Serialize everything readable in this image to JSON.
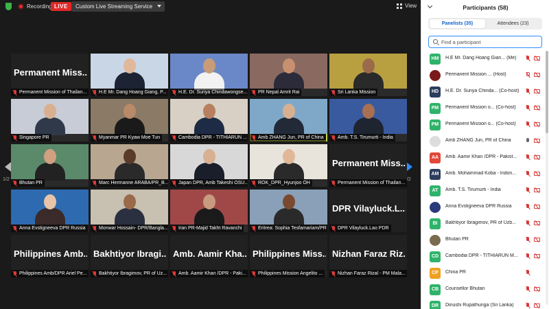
{
  "topbar": {
    "recording_label": "Recording",
    "live_label": "LIVE",
    "stream_service": "Custom Live Streaming Service",
    "view_label": "View"
  },
  "gallery": {
    "page_left": "1/2",
    "page_right": "1/2",
    "tiles": [
      {
        "label": "Permanent Mission of Thailan...",
        "big_name": "Permanent Miss...",
        "video": false,
        "scene": "#3a3a3a"
      },
      {
        "label": "H.E Mr. Dang Hoang Giang, P...",
        "video": true,
        "scene": "#c9d6e6",
        "skin": "#e0b89a",
        "suit": "#1c2433"
      },
      {
        "label": "H.E. Dr. Suriya Chindawongse...",
        "video": true,
        "scene": "#6a88c8",
        "skin": "#c99b78",
        "suit": "#f2f2f2"
      },
      {
        "label": "PR Nepal Amrit Rai",
        "video": true,
        "scene": "#8a6a60",
        "skin": "#c89070",
        "suit": "#2b2b3a"
      },
      {
        "label": "Sri Lanka Mission",
        "video": true,
        "scene": "#b8a040",
        "skin": "#9a6a4a",
        "suit": "#2a2a2a"
      },
      {
        "label": "Singapore PR",
        "video": true,
        "scene": "#c8ccd6",
        "skin": "#d8b090",
        "suit": "#30394a"
      },
      {
        "label": "Myanmar PR Kyaw Moe Tun",
        "video": true,
        "scene": "#8a7a66",
        "skin": "#b88a68",
        "suit": "#1a1a1a"
      },
      {
        "label": "Cambodia DPR - TITHIARUN ...",
        "video": true,
        "scene": "#d8d0c4",
        "skin": "#b88060",
        "suit": "#1d2b44"
      },
      {
        "label": "Amb ZHANG Jun, PR of China",
        "video": true,
        "scene": "#7fa8c8",
        "skin": "#d8b090",
        "suit": "#222a38",
        "active": true
      },
      {
        "label": "Amb. T.S. Tirumurti - India",
        "video": true,
        "scene": "#3a5aa0",
        "skin": "#a87050",
        "suit": "#1e2430"
      },
      {
        "label": "Bhutan PR",
        "video": true,
        "scene": "#5a8a6a",
        "skin": "#d0a080",
        "suit": "#222222"
      },
      {
        "label": "Marc Hermanne ARABA/PR_B...",
        "video": true,
        "scene": "#b8a690",
        "skin": "#5a3a28",
        "suit": "#2a2a2a"
      },
      {
        "label": "Japan DPR, Amb Takeshi OSU...",
        "video": true,
        "scene": "#d8d8d8",
        "skin": "#d8b090",
        "suit": "#1a1e2a"
      },
      {
        "label": "ROK_DPR_Hyunjoo OH",
        "video": true,
        "scene": "#e8e4dc",
        "skin": "#e0b898",
        "suit": "#2a2a2a"
      },
      {
        "label": "Permanent Mission of Thailan...",
        "big_name": "Permanent Miss...",
        "video": false,
        "scene": "#3a3a3a"
      },
      {
        "label": "Anna Evstigneeva DPR Russia",
        "video": true,
        "scene": "#2e6ab0",
        "skin": "#e8c4a8",
        "suit": "#3a2a2a"
      },
      {
        "label": "Monwar Hossain- DPR/Bangla...",
        "video": true,
        "scene": "#c8c0b0",
        "skin": "#9a6a4a",
        "suit": "#2a3040"
      },
      {
        "label": "Iran PR-Majid Takht Ravanchi",
        "video": true,
        "scene": "#a04848",
        "skin": "#c89a80",
        "suit": "#1a1a1a"
      },
      {
        "label": "Eritrea: Sophia Tesfamariam/PR",
        "video": true,
        "scene": "#8aa0b8",
        "skin": "#7a4a30",
        "suit": "#2a2a2a"
      },
      {
        "label": "DPR Vilayluck.Lao PDR",
        "big_name": "DPR Vilayluck.L...",
        "video": false,
        "scene": "#3a3a3a"
      },
      {
        "label": "Philippines Amb/DPR Ariel Pe...",
        "big_name": "Philippines Amb...",
        "video": false
      },
      {
        "label": "Bakhtiyor Ibragimov, PR of Uz...",
        "big_name": "Bakhtiyor Ibragi...",
        "video": false
      },
      {
        "label": "Amb. Aamir Khan /DPR - Paki...",
        "big_name": "Amb. Aamir Kha...",
        "video": false
      },
      {
        "label": "Philippines Mission Angelito ...",
        "big_name": "Philippines Miss...",
        "video": false
      },
      {
        "label": "Nizhan Faraz Rizal - PM Mala...",
        "big_name": "Nizhan Faraz Riz...",
        "video": false
      }
    ]
  },
  "participants": {
    "title": "Participants (58)",
    "tabs": [
      {
        "label": "Panelists (35)",
        "active": true
      },
      {
        "label": "Attendees (23)",
        "active": false
      }
    ],
    "search_placeholder": "Find a participant",
    "list": [
      {
        "initials": "HM",
        "color": "#2fb36a",
        "name": "H.E Mr. Dang Hoang Gian... (Me)",
        "mic": "off",
        "cam": "off"
      },
      {
        "initials": "",
        "color": "#7a1a1a",
        "round": true,
        "name": "Permanent Mission ... (Host)",
        "mic": "ring",
        "cam": "off"
      },
      {
        "initials": "HD",
        "color": "#2c3e5c",
        "name": "H.E. Dr. Suriya Chinda... (Co-host)",
        "mic": "off",
        "cam": "off"
      },
      {
        "initials": "PM",
        "color": "#2fb36a",
        "name": "Permanent Mission o... (Co-host)",
        "mic": "off",
        "cam": "off"
      },
      {
        "initials": "PM",
        "color": "#2fb36a",
        "name": "Permanent Mission o... (Co-host)",
        "mic": "off",
        "cam": "off"
      },
      {
        "initials": "",
        "color": "#dddddd",
        "round": true,
        "name": "Amb ZHANG Jun, PR of China",
        "mic": "on",
        "cam": "off"
      },
      {
        "initials": "AA",
        "color": "#e0483a",
        "name": "Amb. Aamir Khan /DPR - Pakist...",
        "mic": "off",
        "cam": "off"
      },
      {
        "initials": "AM",
        "color": "#2c3e5c",
        "name": "Amb. Mohammad Koba - Indon...",
        "mic": "off",
        "cam": "off"
      },
      {
        "initials": "AT",
        "color": "#2fb36a",
        "name": "Amb. T.S. Tirumurti - India",
        "mic": "off",
        "cam": "off"
      },
      {
        "initials": "",
        "color": "#2a3a7a",
        "round": true,
        "name": "Anna Evstigneeva DPR Russia",
        "mic": "off",
        "cam": "off"
      },
      {
        "initials": "BI",
        "color": "#2fb36a",
        "name": "Bakhtiyor Ibragimov, PR of Uzb...",
        "mic": "off",
        "cam": "off"
      },
      {
        "initials": "",
        "color": "#7a6a50",
        "round": true,
        "name": "Bhutan PR",
        "mic": "off",
        "cam": "off"
      },
      {
        "initials": "CD",
        "color": "#2fb36a",
        "name": "Cambodia DPR - TITHIARUN M...",
        "mic": "off",
        "cam": "off"
      },
      {
        "initials": "CP",
        "color": "#f0a020",
        "name": "China PR",
        "mic": "off",
        "cam": "none"
      },
      {
        "initials": "CB",
        "color": "#2fb36a",
        "name": "Counsellor Bhutan",
        "mic": "off",
        "cam": "off"
      },
      {
        "initials": "DR",
        "color": "#2fb36a",
        "name": "Dinushi Rupathunga (Sri Lanka)",
        "mic": "off",
        "cam": "off"
      }
    ]
  }
}
